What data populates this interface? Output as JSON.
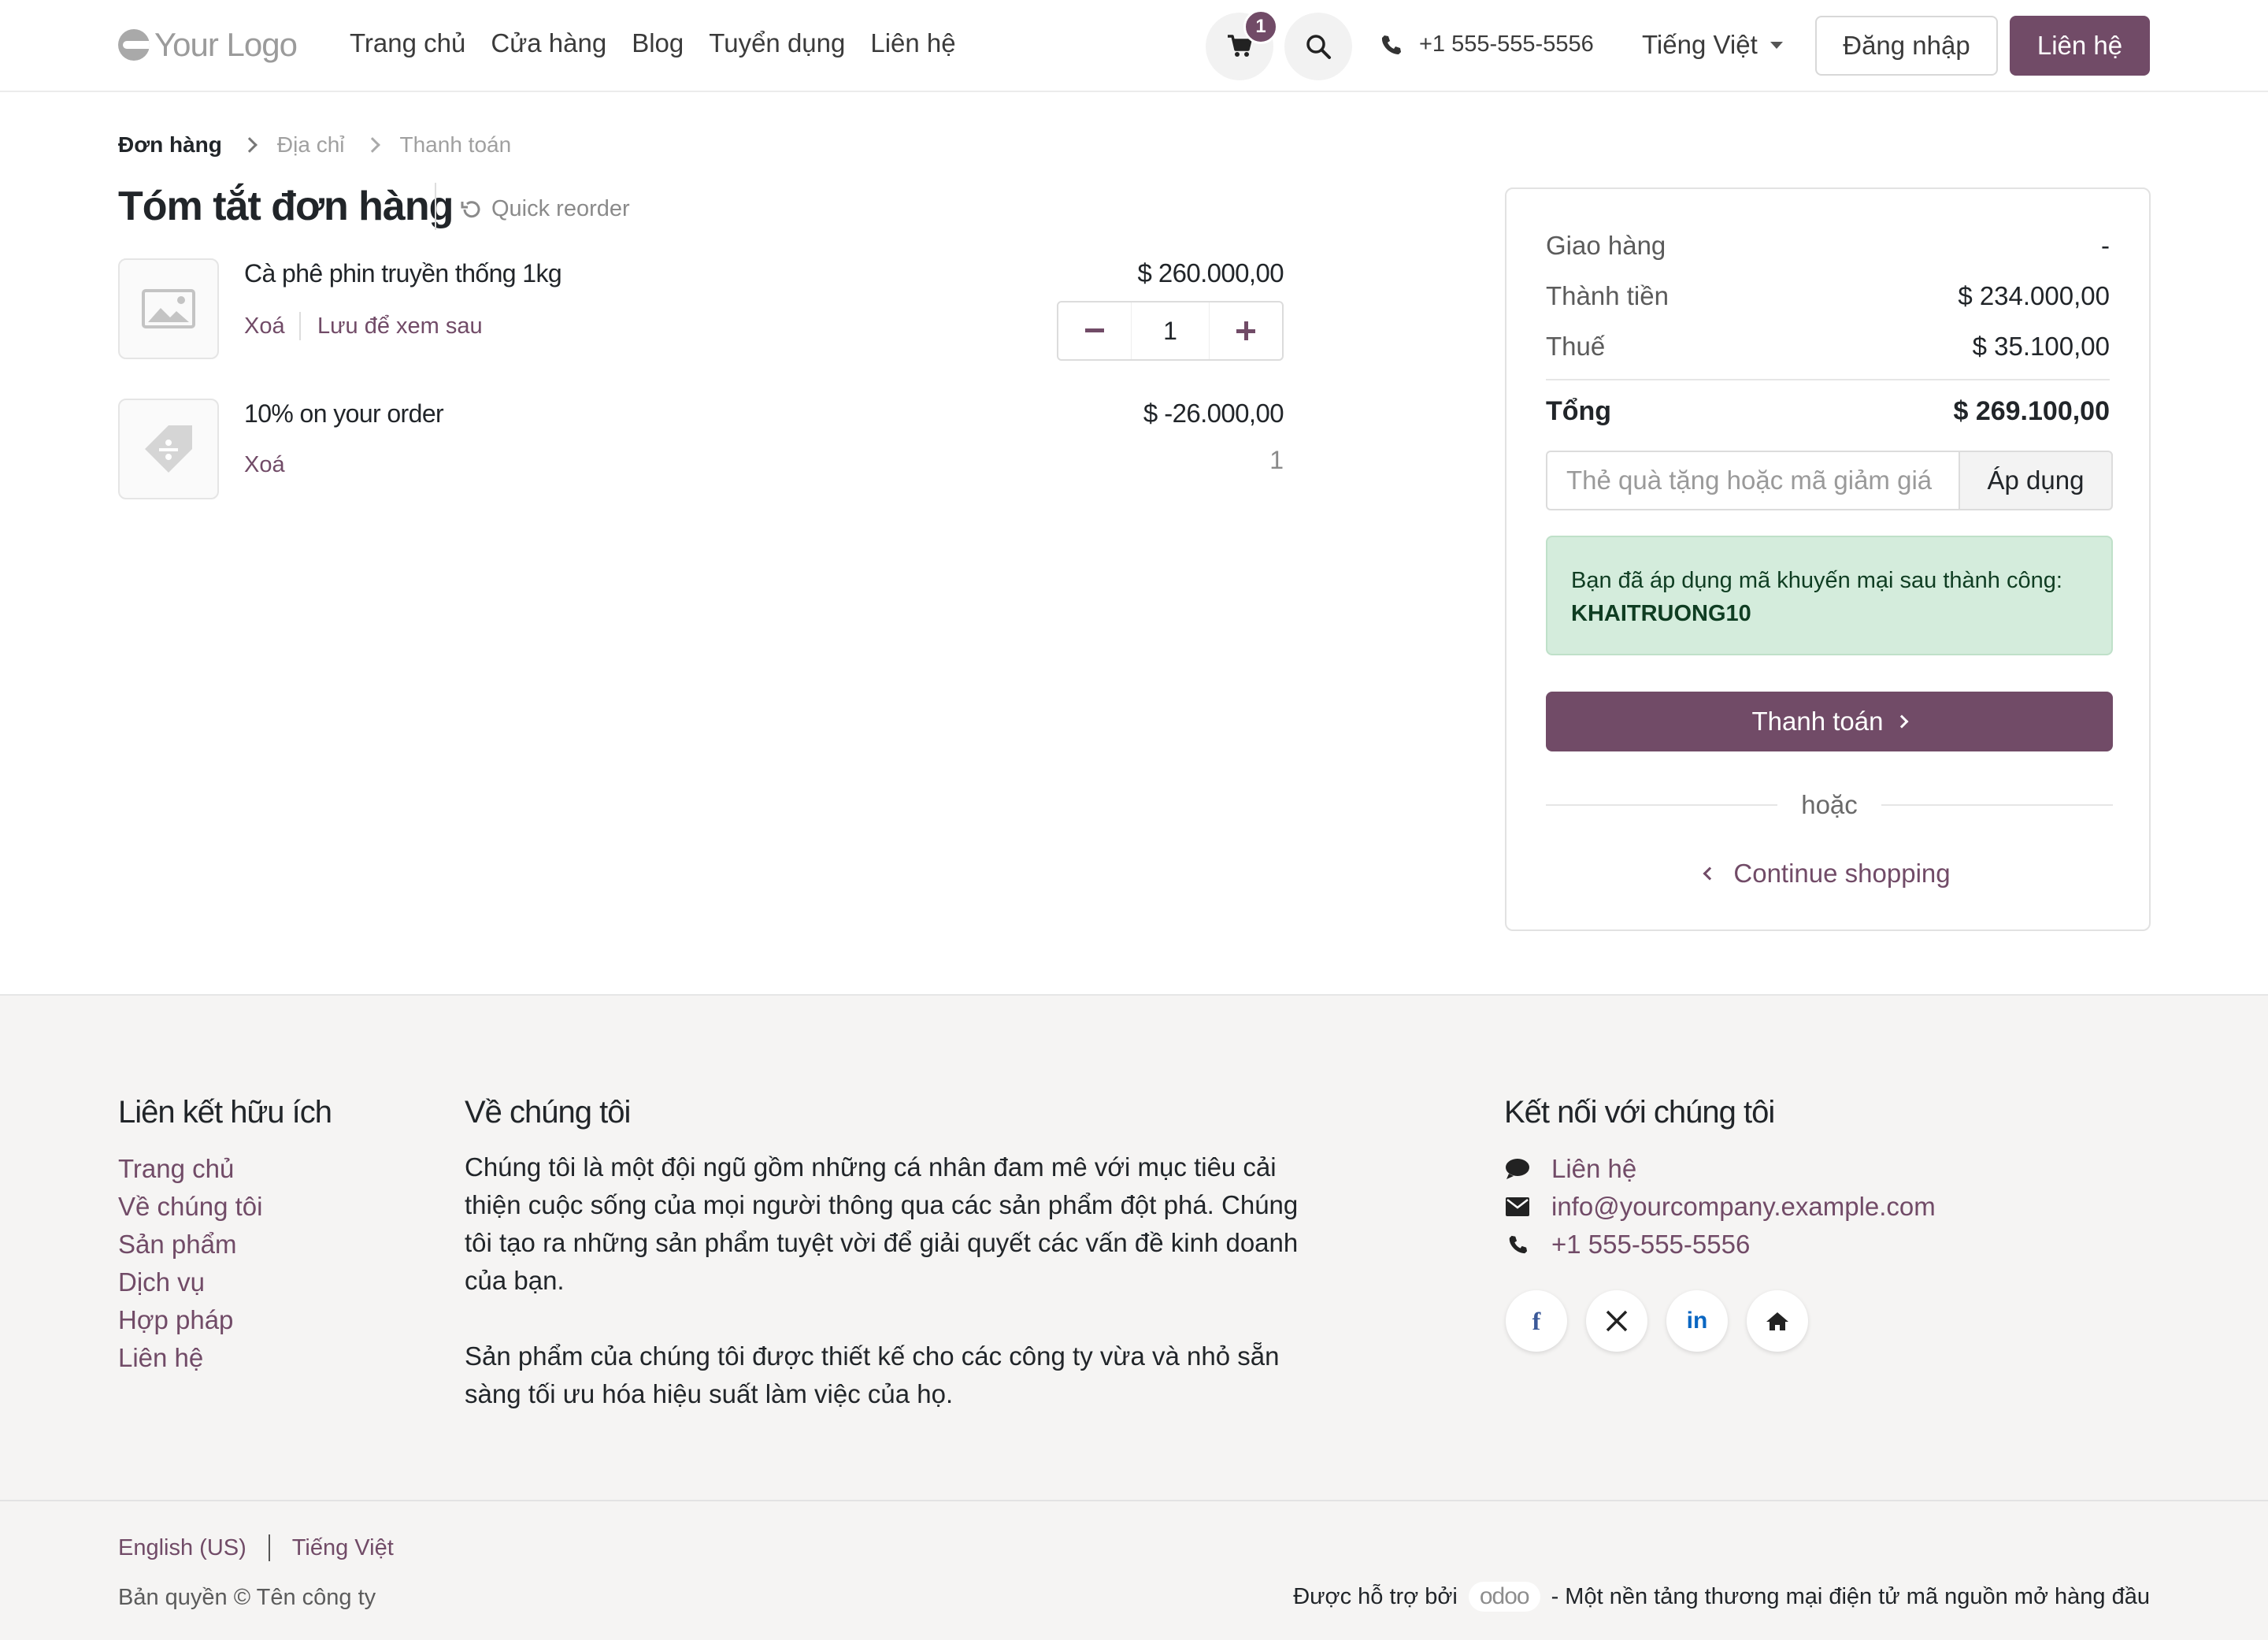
{
  "header": {
    "logo_text": "Your Logo",
    "nav": [
      "Trang chủ",
      "Cửa hàng",
      "Blog",
      "Tuyển dụng",
      "Liên hệ"
    ],
    "cart_count": "1",
    "phone": "+1 555-555-5556",
    "language": "Tiếng Việt",
    "login_label": "Đăng nhập",
    "contact_label": "Liên hệ"
  },
  "breadcrumb": {
    "steps": [
      "Đơn hàng",
      "Địa chỉ",
      "Thanh toán"
    ]
  },
  "main": {
    "title": "Tóm tắt đơn hàng",
    "quick_reorder": "Quick reorder",
    "items": [
      {
        "name": "Cà phê phin truyền thống 1kg",
        "price": "$ 260.000,00",
        "remove": "Xoá",
        "save_later": "Lưu để xem sau",
        "quantity": "1"
      },
      {
        "name": "10% on your order",
        "price": "$ -26.000,00",
        "remove": "Xoá",
        "quantity": "1"
      }
    ]
  },
  "summary": {
    "shipping_label": "Giao hàng",
    "shipping_value": "-",
    "subtotal_label": "Thành tiền",
    "subtotal_value": "$ 234.000,00",
    "tax_label": "Thuế",
    "tax_value": "$ 35.100,00",
    "total_label": "Tổng",
    "total_value": "$ 269.100,00",
    "promo_placeholder": "Thẻ quà tặng hoặc mã giảm giá",
    "apply_label": "Áp dụng",
    "alert_text": "Bạn đã áp dụng mã khuyến mại sau thành công:",
    "alert_code": "KHAITRUONG10",
    "checkout_label": "Thanh toán",
    "or_label": "hoặc",
    "continue_label": "Continue shopping"
  },
  "footer": {
    "links_title": "Liên kết hữu ích",
    "links": [
      "Trang chủ",
      "Về chúng tôi",
      "Sản phẩm",
      "Dịch vụ",
      "Hợp pháp",
      "Liên hệ"
    ],
    "about_title": "Về chúng tôi",
    "about_p1": "Chúng tôi là một đội ngũ gồm những cá nhân đam mê với mục tiêu cải thiện cuộc sống của mọi người thông qua các sản phẩm đột phá. Chúng tôi tạo ra những sản phẩm tuyệt vời để giải quyết các vấn đề kinh doanh của bạn.",
    "about_p2": "Sản phẩm của chúng tôi được thiết kế cho các công ty vừa và nhỏ sẵn sàng tối ưu hóa hiệu suất làm việc của họ.",
    "connect_title": "Kết nối với chúng tôi",
    "contact_link": "Liên hệ",
    "email": "info@yourcompany.example.com",
    "phone": "+1 555-555-5556",
    "socials": [
      "facebook-icon",
      "x-icon",
      "linkedin-icon",
      "home-icon"
    ],
    "lang_en": "English (US)",
    "lang_vi": "Tiếng Việt",
    "copyright": "Bản quyền © Tên công ty",
    "powered_prefix": "Được hỗ trợ bởi",
    "powered_brand": "odoo",
    "powered_suffix": "- Một nền tảng thương mại điện tử mã nguồn mở hàng đầu"
  },
  "colors": {
    "brand": "#714b67",
    "success_bg": "#d4ecdc",
    "footer_bg": "#f5f4f3"
  }
}
